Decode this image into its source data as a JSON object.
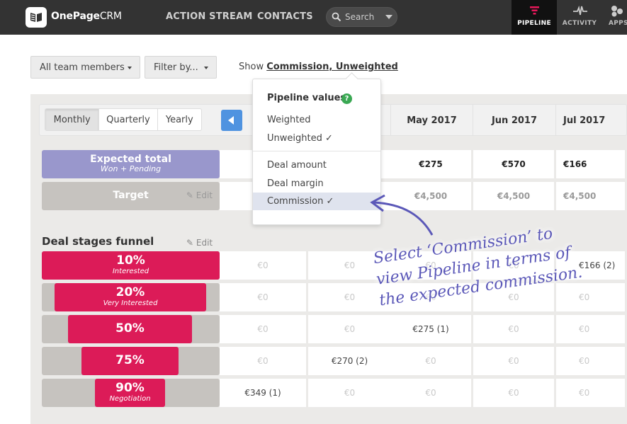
{
  "header": {
    "logo_bold": "OnePage",
    "logo_light": "CRM",
    "nav": [
      "ACTION STREAM",
      "CONTACTS"
    ],
    "search_placeholder": "Search",
    "right_tabs": [
      {
        "label": "PIPELINE",
        "icon": "funnel-icon",
        "active": true
      },
      {
        "label": "ACTIVITY",
        "icon": "pulse-icon",
        "active": false
      },
      {
        "label": "APPS",
        "icon": "apps-icon",
        "active": false
      }
    ]
  },
  "filters": {
    "team": "All team members",
    "filter": "Filter by...",
    "show_prefix": "Show",
    "show_value": "Commission, Unweighted"
  },
  "period": {
    "options": [
      "Monthly",
      "Quarterly",
      "Yearly"
    ],
    "selected": "Monthly"
  },
  "months": [
    "May 2017",
    "Jun 2017",
    "Jul 2017"
  ],
  "expected_total": {
    "title": "Expected total",
    "subtitle": "Won + Pending",
    "values": [
      "€275",
      "€570",
      "€166"
    ]
  },
  "target": {
    "title": "Target",
    "edit": "Edit",
    "values": [
      "€4,500",
      "€4,500",
      "€4,500"
    ]
  },
  "funnel": {
    "title": "Deal stages funnel",
    "edit": "Edit",
    "stages": [
      {
        "pct": "10%",
        "name": "Interested",
        "cells": [
          "€0",
          "€0",
          "€0",
          "€0",
          "€166 (2)"
        ]
      },
      {
        "pct": "20%",
        "name": "Very Interested",
        "cells": [
          "€0",
          "€0",
          "€0",
          "€0",
          "€0"
        ]
      },
      {
        "pct": "50%",
        "name": "",
        "cells": [
          "€0",
          "€0",
          "€275 (1)",
          "€0",
          "€0"
        ]
      },
      {
        "pct": "75%",
        "name": "",
        "cells": [
          "€0",
          "€270 (2)",
          "€0",
          "€0",
          "€0"
        ]
      },
      {
        "pct": "90%",
        "name": "Negotiation",
        "cells": [
          "€349 (1)",
          "€0",
          "€0",
          "€0",
          "€0"
        ]
      }
    ]
  },
  "popover": {
    "title": "Pipeline values",
    "help": "?",
    "group1": [
      "Weighted",
      "Unweighted ✓"
    ],
    "group2": [
      "Deal amount",
      "Deal margin",
      "Commission ✓"
    ],
    "selected": "Commission ✓"
  },
  "annotation": {
    "lines": [
      "Select ‘Commission’ to",
      "view Pipeline in terms of",
      "the expected commission."
    ],
    "color": "#5b58b8"
  },
  "colors": {
    "accent": "#dc1b58",
    "expected": "#9997cc",
    "target": "#c6c3bf",
    "nav_bg": "#333333",
    "prev_button": "#4f93e0"
  }
}
